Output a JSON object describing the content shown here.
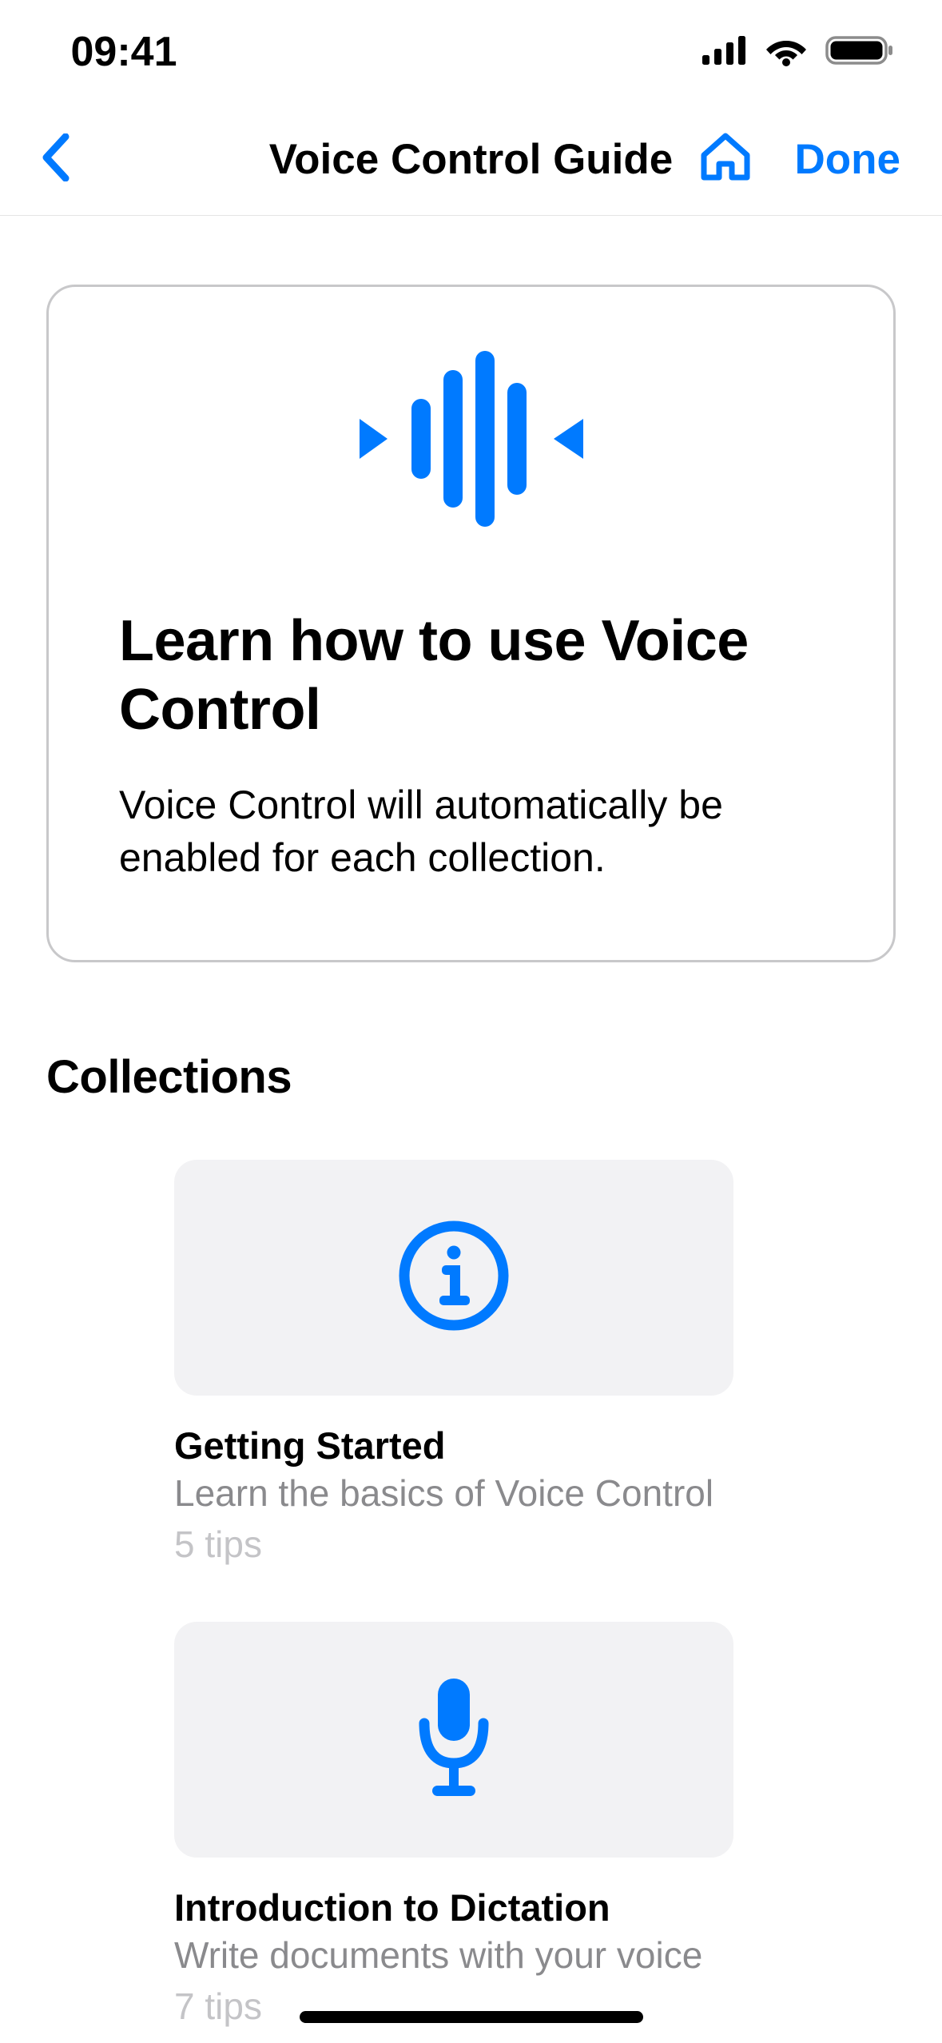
{
  "status": {
    "time": "09:41"
  },
  "nav": {
    "title": "Voice Control Guide",
    "done_label": "Done"
  },
  "hero": {
    "title": "Learn how to use Voice Control",
    "subtitle": "Voice Control will automatically be enabled for each collection."
  },
  "sections": {
    "collections_heading": "Collections"
  },
  "collections": [
    {
      "icon": "info",
      "title": "Getting Started",
      "description": "Learn the basics of Voice Control",
      "count": "5 tips"
    },
    {
      "icon": "microphone",
      "title": "Introduction to Dictation",
      "description": "Write documents with your voice",
      "count": "7 tips"
    }
  ],
  "colors": {
    "accent": "#007AFF"
  }
}
